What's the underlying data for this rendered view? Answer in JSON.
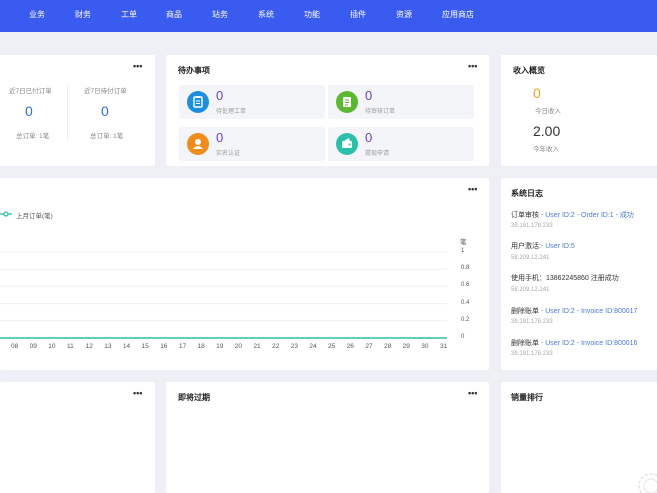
{
  "nav": [
    "业务",
    "财务",
    "工单",
    "商品",
    "站务",
    "系统",
    "功能",
    "插件",
    "资源",
    "应用商店"
  ],
  "orders": {
    "paid_label": "近7日已付订单",
    "paid_value": "0",
    "paid_total": "总订单: 1笔",
    "pending_label": "近7日待付订单",
    "pending_value": "0",
    "pending_total": "总订单: 1笔"
  },
  "todo": {
    "title": "待办事项",
    "items": [
      {
        "value": "0",
        "label": "待处理工单",
        "color": "#1e8fe0",
        "icon": "clipboard-icon"
      },
      {
        "value": "0",
        "label": "待审核订单",
        "color": "#5cb82e",
        "icon": "list-icon"
      },
      {
        "value": "0",
        "label": "实名认证",
        "color": "#f08c1a",
        "icon": "user-icon"
      },
      {
        "value": "0",
        "label": "提现申请",
        "color": "#2bbfa8",
        "icon": "wallet-icon"
      }
    ]
  },
  "income": {
    "title": "收入概览",
    "today_value": "0",
    "today_label": "今日收入",
    "year_value": "2.00",
    "year_label": "今年收入"
  },
  "chart_data": {
    "type": "line",
    "legend": [
      "上月订单(笔)"
    ],
    "ylabel": "笔",
    "x": [
      "08",
      "09",
      "10",
      "11",
      "12",
      "13",
      "14",
      "15",
      "16",
      "17",
      "18",
      "19",
      "20",
      "21",
      "22",
      "23",
      "24",
      "25",
      "26",
      "27",
      "28",
      "29",
      "30",
      "31"
    ],
    "series": [
      {
        "name": "上月订单(笔)",
        "values": [
          0,
          0,
          0,
          0,
          0,
          0,
          0,
          0,
          0,
          0,
          0,
          0,
          0,
          0,
          0,
          0,
          0,
          0,
          0,
          0,
          0,
          0,
          0,
          0
        ]
      }
    ],
    "yticks": [
      "1",
      "0.8",
      "0.6",
      "0.4",
      "0.2",
      "0"
    ],
    "ylim": [
      0,
      1
    ],
    "color": "#2bbfa8"
  },
  "syslog": {
    "title": "系统日志",
    "entries": [
      {
        "action": "订单审核",
        "detail": " - User ID:2 - Order ID:1 - 成功",
        "ip": "39.191.178.233"
      },
      {
        "action": "用户激活:",
        "detail": "- User ID:5",
        "ip": "58.209.12.241"
      },
      {
        "action": "使用手机：13862245860 注册成功",
        "detail": "",
        "ip": "58.209.12.241"
      },
      {
        "action": "删除账单",
        "detail": " - User ID:2 - Invoice ID:800017",
        "ip": "39.191.178.233"
      },
      {
        "action": "删除账单",
        "detail": " - User ID:2 - Invoice ID:800016",
        "ip": "39.191.178.233"
      }
    ]
  },
  "expiring": {
    "title": "即将过期"
  },
  "sales": {
    "title": "销量排行"
  },
  "more": "•••"
}
